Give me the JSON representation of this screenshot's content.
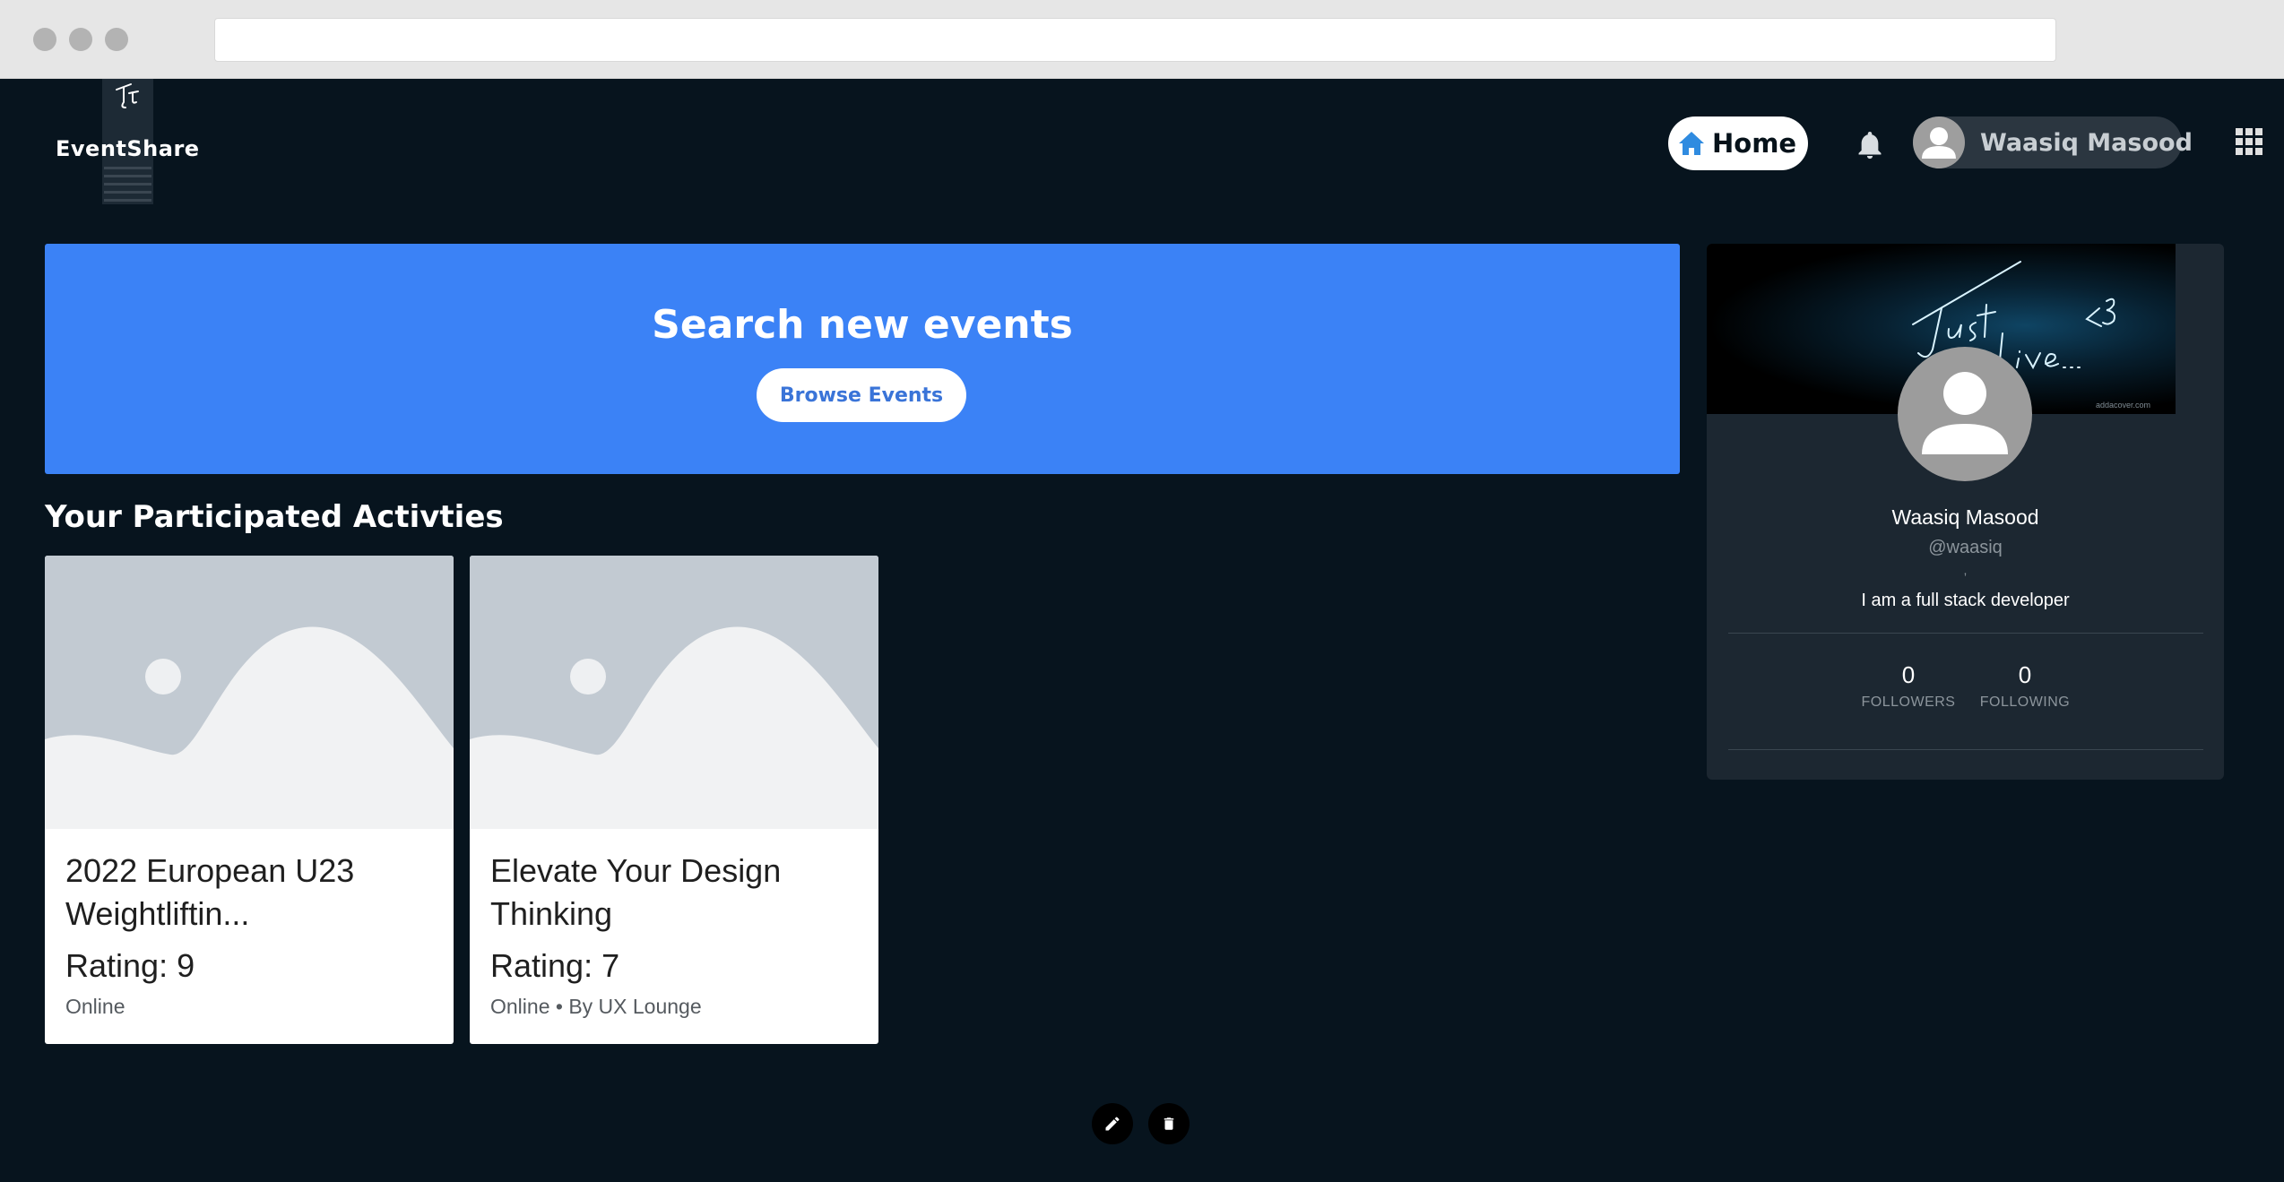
{
  "app": {
    "brand": "EventShare"
  },
  "header": {
    "home_label": "Home",
    "user_name": "Waasiq Masood"
  },
  "hero": {
    "title": "Search new events",
    "button_label": "Browse Events",
    "color": "#3b82f6"
  },
  "section": {
    "title": "Your Participated Activties"
  },
  "cards": [
    {
      "title": "2022 European U23 Weightliftin...",
      "rating": "Rating: 9",
      "meta": "Online"
    },
    {
      "title": "Elevate Your Design Thinking",
      "rating": "Rating: 7",
      "meta": "Online • By UX Lounge"
    }
  ],
  "profile": {
    "cover_text": "Just Live...<3",
    "cover_site": "addacover.com",
    "name": "Waasiq Masood",
    "handle": "@waasiq",
    "separator": ",",
    "bio": "I am a full stack developer",
    "followers_count": "0",
    "followers_label": "FOLLOWERS",
    "following_count": "0",
    "following_label": "FOLLOWING"
  },
  "icons": {
    "home": "home-icon",
    "notifications": "bell-icon",
    "apps": "grid-icon",
    "edit": "pencil-icon",
    "delete": "trash-icon"
  },
  "colors": {
    "background": "#07141e",
    "panel": "#1c2731",
    "accent": "#3b82f6",
    "home_icon": "#2f8be0"
  }
}
